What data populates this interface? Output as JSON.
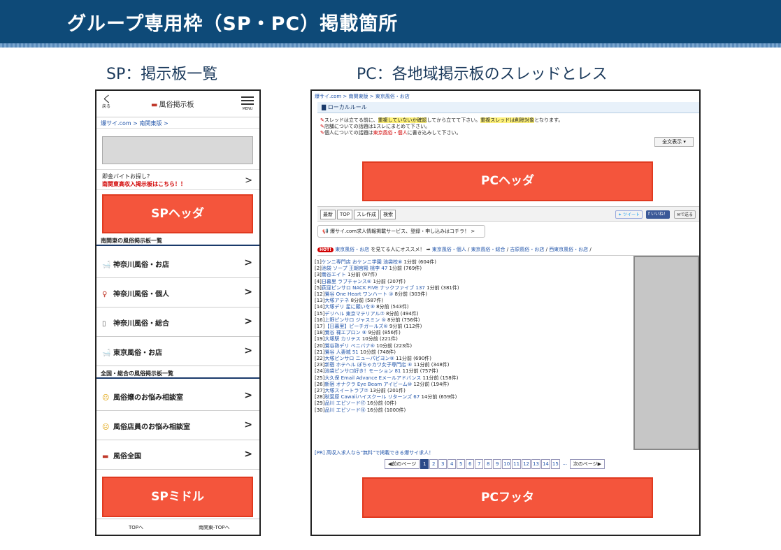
{
  "title": "グループ専用枠（SP・PC）掲載箇所",
  "captions": {
    "sp": "SP：掲示板一覧",
    "pc": "PC：各地域掲示板のスレッドとレス"
  },
  "sp": {
    "back": "く",
    "back_sub": "戻る",
    "logo": "風俗掲示板",
    "menu": "MENU",
    "breadcrumb": "爆サイ.com > 南関東版 >",
    "job_line1": "即金バイトお探し？",
    "job_line2": "南関東高収入掲示板はこちら！！",
    "header_box": "SPヘッダ",
    "section1": "南関東の風俗掲示板一覧",
    "items1": [
      "神奈川風俗・お店",
      "神奈川風俗・個人",
      "神奈川風俗・総合",
      "東京風俗・お店"
    ],
    "section2": "全国・総合の風俗掲示板一覧",
    "items2": [
      "風俗嬢のお悩み相談室",
      "風俗店員のお悩み相談室",
      "風俗全国"
    ],
    "middle_box": "SPミドル",
    "bottom_left": "TOPへ",
    "bottom_right": "南関東-TOPへ",
    "chevron": ">"
  },
  "pc": {
    "breadcrumb": "爆サイ.com > 南関東版 > 東京風俗・お店",
    "local_rule": "ローカルルール",
    "rule1a": "スレッドは立てる前に、",
    "rule1b": "重複していないか確認",
    "rule1c": "してから立てて下さい。",
    "rule1d": "重複スレッドは削除対象",
    "rule1e": "となります。",
    "rule2": "店舗についての話題は1スレにまとめて下さい。",
    "rule3a": "個人についての話題は",
    "rule3b": "東京風俗・個人",
    "rule3c": "に書き込みして下さい。",
    "full_view": "全文表示 ▾",
    "header_box": "PCヘッダ",
    "tool_buttons": [
      "最新",
      "TOP",
      "スレ作成",
      "検索"
    ],
    "tweet": "ツイート",
    "like": "いいね！",
    "send": "で送る",
    "ad_text": "爆サイ.com求人情報掲載サービス、登録・申し込みはコチラ！ >",
    "hot_badge": "HOT!",
    "hot_link": "東京風俗・お店",
    "hot_mid": "を見てる人にオススメ！ ➡",
    "hot_links": [
      "東京風俗・個人",
      "東京風俗・総合",
      "吉原風俗・お店",
      "西東京風俗・お店"
    ],
    "threads": [
      [
        "[1]",
        "ケンニ専門店 おケンニ学園 池袋校⑧",
        "1分前 (604件)"
      ],
      [
        "[2]",
        "池袋 ソープ 王朝官殿 桃李 47",
        "1分前 (769件)"
      ],
      [
        "[3]",
        "鶯谷エイト",
        "1分前 (97件)"
      ],
      [
        "[4]",
        "日暮里 ラブチャンス⑥",
        "1分前 (207件)"
      ],
      [
        "[5]",
        "荻窪ピンサロ NACK FIVE ナックファイブ 137",
        "1分前 (381件)"
      ],
      [
        "[12]",
        "鶯谷 One Heart ワンハート ③",
        "8分前 (303件)"
      ],
      [
        "[13]",
        "大塚アテネ",
        "8分前 (587件)"
      ],
      [
        "[14]",
        "大塚デリ 星に願いを⑧",
        "8分前 (543件)"
      ],
      [
        "[15]",
        "デリヘル 東京マテリアル⑦",
        "8分前 (494件)"
      ],
      [
        "[16]",
        "上野ピンサロ ジャスミン ⑤",
        "8分前 (756件)"
      ],
      [
        "[17]",
        "【日暮里】ピーチガールズ⑥",
        "9分前 (112件)"
      ],
      [
        "[18]",
        "鶯谷 裸エプロン ⑧",
        "9分前 (856件)"
      ],
      [
        "[19]",
        "大塚駅 カリテス",
        "10分前 (221件)"
      ],
      [
        "[20]",
        "鶯谷熟デリ ベニバナ⑥",
        "10分前 (223件)"
      ],
      [
        "[21]",
        "鶯谷 人妻城 51",
        "10分前 (748件)"
      ],
      [
        "[22]",
        "大塚ピンサロ ニューパピヨン⑨",
        "11分前 (690件)"
      ],
      [
        "[23]",
        "新宿 ホテヘル ぽちゃカワ女子専門店 ⑥",
        "11分前 (348件)"
      ],
      [
        "[24]",
        "池袋ピンサロ好き！モーション 81",
        "11分前 (757件)"
      ],
      [
        "[25]",
        "大久保 Email Advance Eメールアドバンス",
        "11分前 (158件)"
      ],
      [
        "[26]",
        "新宿 オナクラ Eye Beam アイビーム⑩",
        "12分前 (194件)"
      ],
      [
        "[27]",
        "大塚スイートラブ⑦",
        "13分前 (201件)"
      ],
      [
        "[28]",
        "秋葉原 Cawaiiハイスクール リターンズ 67",
        "14分前 (659件)"
      ],
      [
        "[29]",
        "品川 エピソード⑰",
        "16分前 (0件)"
      ],
      [
        "[30]",
        "品川 エピソード⑯",
        "16分前 (1000件)"
      ]
    ],
    "pr_line": "[PR] 高収入求人なら\"無料\"で掲載できる爆サイ求人！",
    "prev_page": "◀前のページ",
    "pages": [
      "1",
      "2",
      "3",
      "4",
      "5",
      "6",
      "7",
      "8",
      "9",
      "10",
      "11",
      "12",
      "13",
      "14",
      "15"
    ],
    "current_page": "1",
    "ellipsis": "...",
    "next_page": "次のページ▶",
    "footer_box": "PCフッタ"
  },
  "colors": {
    "title_bg": "#0e4a78",
    "ad_box": "#f4553c",
    "link": "#2255aa"
  }
}
